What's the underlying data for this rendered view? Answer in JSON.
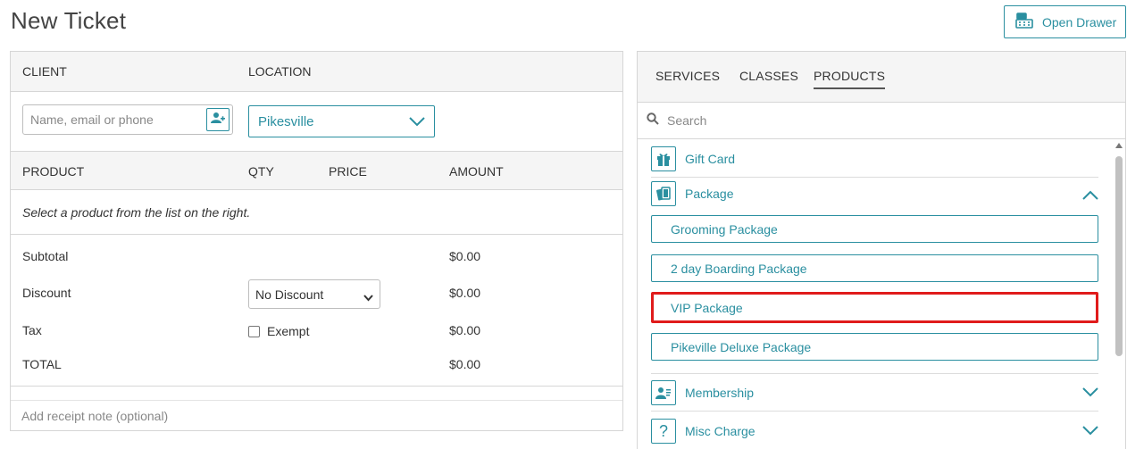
{
  "page": {
    "title": "New Ticket"
  },
  "header": {
    "open_drawer_label": "Open Drawer"
  },
  "client_section": {
    "client_label": "CLIENT",
    "location_label": "LOCATION",
    "client_placeholder": "Name, email or phone",
    "location_value": "Pikesville"
  },
  "product_table": {
    "columns": [
      "PRODUCT",
      "QTY",
      "PRICE",
      "AMOUNT"
    ],
    "empty_message": "Select a product from the list on the right."
  },
  "summary": {
    "subtotal_label": "Subtotal",
    "subtotal_value": "$0.00",
    "discount_label": "Discount",
    "discount_value": "$0.00",
    "discount_select": "No Discount",
    "tax_label": "Tax",
    "tax_value": "$0.00",
    "exempt_label": "Exempt",
    "total_label": "TOTAL",
    "total_value": "$0.00"
  },
  "receipt": {
    "placeholder": "Add receipt note (optional)"
  },
  "tabs": [
    {
      "label": "SERVICES"
    },
    {
      "label": "CLASSES"
    },
    {
      "label": "PRODUCTS"
    }
  ],
  "search": {
    "placeholder": "Search"
  },
  "categories": {
    "gift_card": {
      "label": "Gift Card",
      "icon": "gift-icon"
    },
    "package": {
      "label": "Package",
      "icon": "package-icon",
      "expanded": true
    },
    "membership": {
      "label": "Membership",
      "icon": "membership-icon"
    },
    "misc_charge": {
      "label": "Misc Charge",
      "icon": "question-icon"
    }
  },
  "packages": [
    {
      "label": "Grooming Package"
    },
    {
      "label": "2 day Boarding Package"
    },
    {
      "label": "VIP Package"
    },
    {
      "label": "Pikeville Deluxe Package"
    }
  ],
  "colors": {
    "accent": "#2a8fa0",
    "highlight": "#e01b1b",
    "border": "#d6d6d6"
  }
}
